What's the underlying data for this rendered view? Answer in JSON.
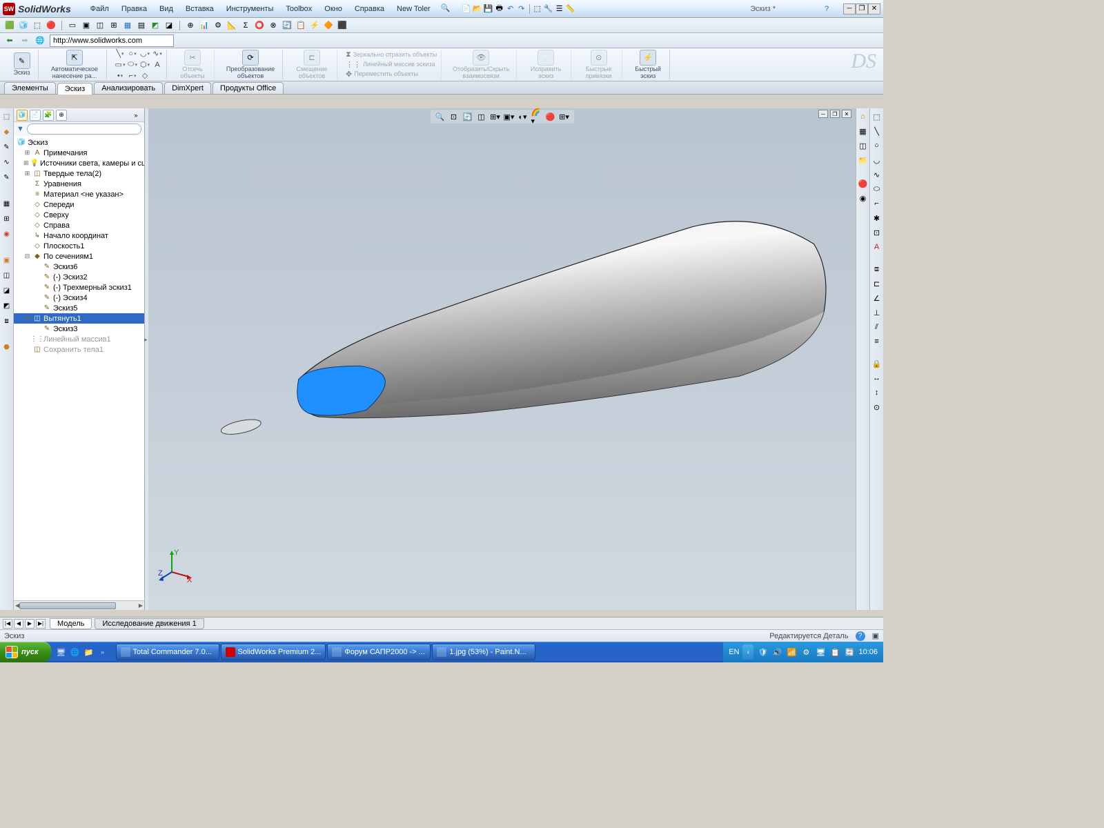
{
  "app": {
    "name": "SolidWorks",
    "doc_title": "Эскиз *"
  },
  "menu": [
    "Файл",
    "Правка",
    "Вид",
    "Вставка",
    "Инструменты",
    "Toolbox",
    "Окно",
    "Справка",
    "New Toler"
  ],
  "address": {
    "url": "http://www.solidworks.com"
  },
  "ribbon": {
    "sketch": "Эскиз",
    "auto_dim": "Автоматическое нанесение ра...",
    "trim": "Отсечь объекты",
    "convert": "Преобразование объектов",
    "offset": "Смещение объектов",
    "mirror": "Зеркально отразить объекты",
    "pattern": "Линейный массив эскиза",
    "move": "Переместить объекты",
    "display": "Отобразить/Скрыть взаимосвязи",
    "repair": "Исправить эскиз",
    "quick_snaps": "Быстрые привязки",
    "rapid": "Быстрый эскиз"
  },
  "tabs": [
    "Элементы",
    "Эскиз",
    "Анализировать",
    "DimXpert",
    "Продукты Office"
  ],
  "active_tab": "Эскиз",
  "tree": {
    "root": "Эскиз",
    "items": [
      {
        "label": "Примечания",
        "icon": "A",
        "exp": "+"
      },
      {
        "label": "Источники света, камеры и сцены",
        "icon": "💡",
        "exp": "+"
      },
      {
        "label": "Твердые тела(2)",
        "icon": "◫",
        "exp": "+"
      },
      {
        "label": "Уравнения",
        "icon": "Σ"
      },
      {
        "label": "Материал <не указан>",
        "icon": "≡"
      },
      {
        "label": "Спереди",
        "icon": "◇"
      },
      {
        "label": "Сверху",
        "icon": "◇"
      },
      {
        "label": "Справа",
        "icon": "◇"
      },
      {
        "label": "Начало координат",
        "icon": "↳"
      },
      {
        "label": "Плоскость1",
        "icon": "◇"
      },
      {
        "label": "По сечениям1",
        "icon": "◆",
        "exp": "-",
        "children": [
          {
            "label": "Эскиз6",
            "icon": "✎"
          },
          {
            "label": "(-) Эскиз2",
            "icon": "✎"
          },
          {
            "label": "(-) Трехмерный эскиз1",
            "icon": "✎"
          },
          {
            "label": "(-) Эскиз4",
            "icon": "✎"
          },
          {
            "label": "Эскиз5",
            "icon": "✎"
          }
        ]
      },
      {
        "label": "Вытянуть1",
        "icon": "◫",
        "exp": "-",
        "sel": true,
        "children": [
          {
            "label": "Эскиз3",
            "icon": "✎"
          }
        ]
      },
      {
        "label": "Линейный массив1",
        "icon": "⋮⋮",
        "dim": true
      },
      {
        "label": "Сохранить тела1",
        "icon": "◫",
        "dim": true
      }
    ]
  },
  "bottom_tabs": {
    "model": "Модель",
    "motion": "Исследование движения 1"
  },
  "status": {
    "left": "Эскиз",
    "right": "Редактируется Деталь"
  },
  "taskbar": {
    "start": "пуск",
    "tasks": [
      "Total Commander 7.0...",
      "SolidWorks Premium 2...",
      "Форум САПР2000 -> ...",
      "1.jpg (53%) - Paint.N..."
    ],
    "lang": "EN",
    "time": "10:06"
  }
}
